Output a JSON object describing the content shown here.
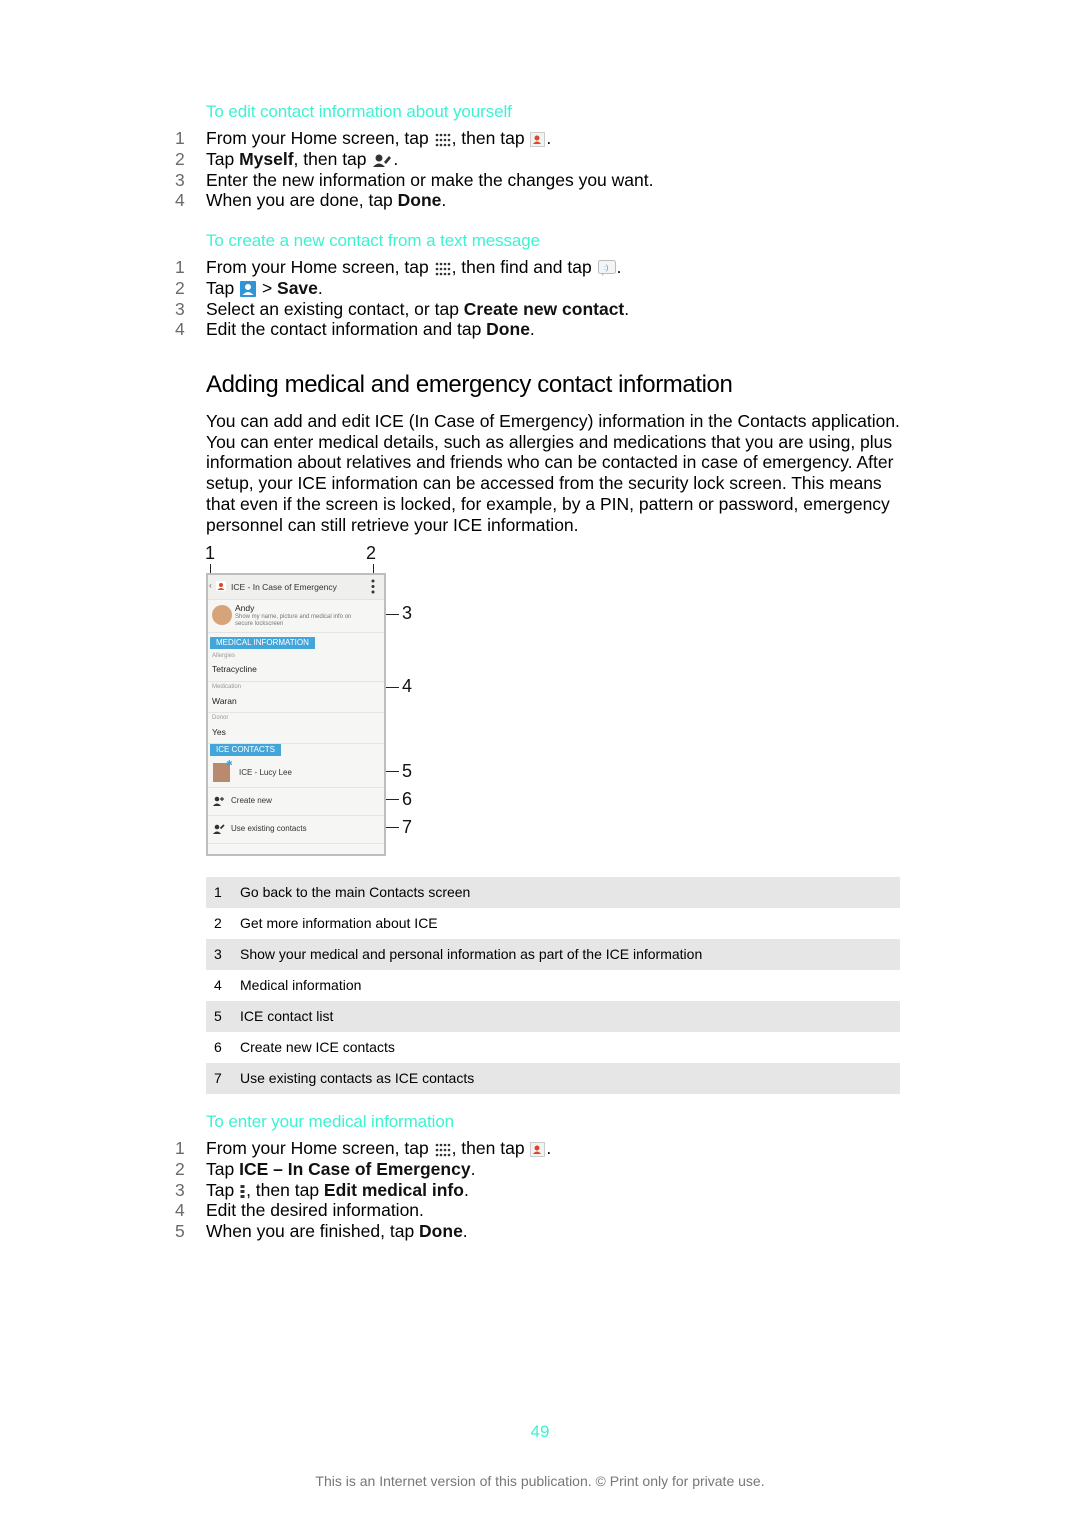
{
  "section1": {
    "heading": "To edit contact information about yourself",
    "steps": [
      {
        "n": "1",
        "parts": [
          "From your Home screen, tap ",
          "",
          ", then tap ",
          "",
          "."
        ]
      },
      {
        "n": "2",
        "parts": [
          "Tap ",
          "Myself",
          ", then tap ",
          "",
          "."
        ]
      },
      {
        "n": "3",
        "text": "Enter the new information or make the changes you want."
      },
      {
        "n": "4",
        "parts": [
          "When you are done, tap ",
          "Done",
          "."
        ]
      }
    ]
  },
  "section2": {
    "heading": "To create a new contact from a text message",
    "steps": [
      {
        "n": "1",
        "parts": [
          "From your Home screen, tap ",
          "",
          ", then find and tap ",
          "",
          "."
        ]
      },
      {
        "n": "2",
        "parts": [
          "Tap ",
          "",
          " > ",
          "Save",
          "."
        ]
      },
      {
        "n": "3",
        "parts": [
          "Select an existing contact, or tap ",
          "Create new contact",
          "."
        ]
      },
      {
        "n": "4",
        "parts": [
          "Edit the contact information and tap ",
          "Done",
          "."
        ]
      }
    ]
  },
  "main": {
    "title": "Adding medical and emergency contact information",
    "paragraph": "You can add and edit ICE (In Case of Emergency) information in the Contacts application. You can enter medical details, such as allergies and medications that you are using, plus information about relatives and friends who can be contacted in case of emergency. After setup, your ICE information can be accessed from the security lock screen. This means that even if the screen is locked, for example, by a PIN, pattern or password, emergency personnel can still retrieve your ICE information."
  },
  "figure": {
    "app_title": "ICE - In Case of Emergency",
    "owner_name": "Andy",
    "owner_desc_1": "Show my name, picture and medical info on",
    "owner_desc_2": "secure lockscreen",
    "medical_section": "MEDICAL INFORMATION",
    "fields": [
      {
        "label": "Allergies",
        "value": "Tetracycline"
      },
      {
        "label": "Medication",
        "value": "Waran"
      },
      {
        "label": "Donor",
        "value": "Yes"
      }
    ],
    "ice_section": "ICE CONTACTS",
    "ice_contact": "ICE - Lucy Lee",
    "create_new": "Create new",
    "use_existing": "Use existing contacts",
    "callouts": [
      "1",
      "2",
      "3",
      "4",
      "5",
      "6",
      "7"
    ],
    "accent_color": "#43a6da"
  },
  "legend": [
    {
      "n": "1",
      "text": "Go back to the main Contacts screen"
    },
    {
      "n": "2",
      "text": "Get more information about ICE"
    },
    {
      "n": "3",
      "text": "Show your medical and personal information as part of the ICE information"
    },
    {
      "n": "4",
      "text": "Medical information"
    },
    {
      "n": "5",
      "text": "ICE contact list"
    },
    {
      "n": "6",
      "text": "Create new ICE contacts"
    },
    {
      "n": "7",
      "text": "Use existing contacts as ICE contacts"
    }
  ],
  "section3": {
    "heading": "To enter your medical information",
    "steps": [
      {
        "n": "1",
        "parts": [
          "From your Home screen, tap ",
          "",
          ", then tap ",
          "",
          "."
        ]
      },
      {
        "n": "2",
        "parts": [
          "Tap ",
          "ICE – In Case of Emergency",
          "."
        ]
      },
      {
        "n": "3",
        "parts": [
          "Tap ",
          "",
          ", then tap ",
          "Edit medical info",
          "."
        ]
      },
      {
        "n": "4",
        "text": "Edit the desired information."
      },
      {
        "n": "5",
        "parts": [
          "When you are finished, tap ",
          "Done",
          "."
        ]
      }
    ]
  },
  "page_number": "49",
  "footer": "This is an Internet version of this publication. © Print only for private use.",
  "colors": {
    "heading": "#3ef2d0",
    "shade": "#e6e6e6"
  }
}
